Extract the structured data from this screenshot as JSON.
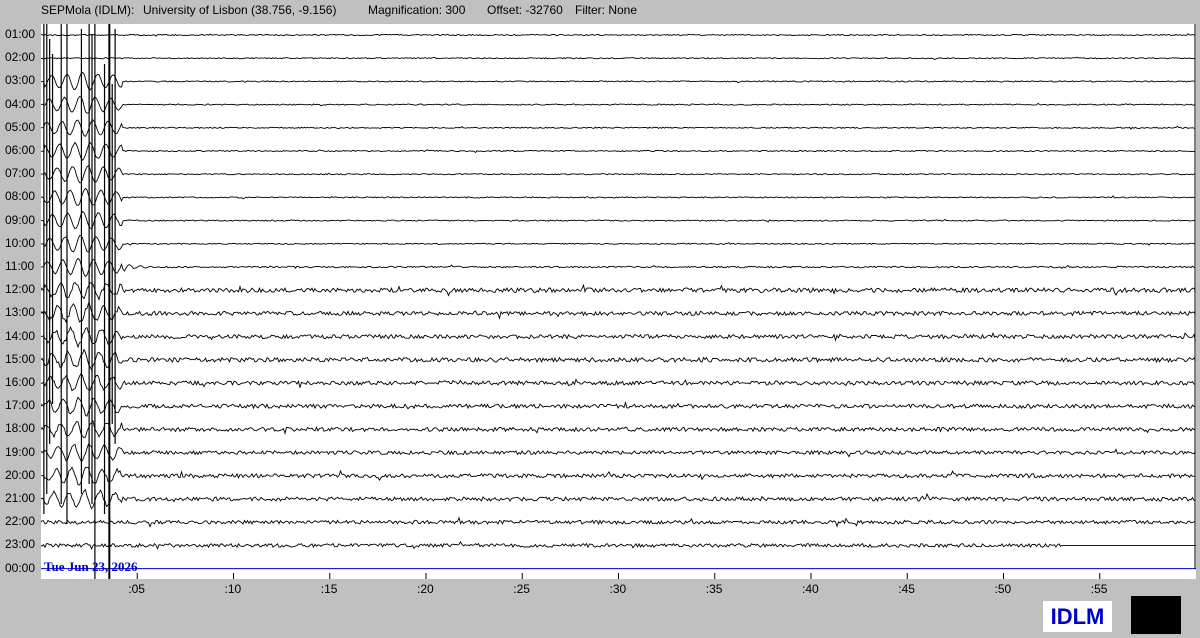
{
  "header": {
    "station": "SEPMola (IDLM):",
    "location": "University of Lisbon (38.756, -9.156)",
    "magnification": "Magnification: 300",
    "offset": "Offset: -32760",
    "filter": "Filter: None"
  },
  "chart_data": {
    "type": "helicorder",
    "hour_labels": [
      "01:00",
      "02:00",
      "03:00",
      "04:00",
      "05:00",
      "06:00",
      "07:00",
      "08:00",
      "09:00",
      "10:00",
      "11:00",
      "12:00",
      "13:00",
      "14:00",
      "15:00",
      "16:00",
      "17:00",
      "18:00",
      "19:00",
      "20:00",
      "21:00",
      "22:00",
      "23:00",
      "00:00"
    ],
    "minute_labels": [
      ":05",
      ":10",
      ":15",
      ":20",
      ":25",
      ":30",
      ":35",
      ":40",
      ":45",
      ":50",
      ":55"
    ],
    "minute_ticks": [
      5,
      10,
      15,
      20,
      25,
      30,
      35,
      40,
      45,
      50,
      55
    ],
    "x_range_minutes": [
      0,
      60
    ],
    "date_label": "Tue Jun 23, 2026",
    "trace_color": "#000000",
    "current_line_color": "#0000cc",
    "noise_amplitude_by_hour": [
      0.6,
      0.6,
      0.6,
      0.6,
      0.6,
      0.6,
      0.6,
      0.6,
      0.6,
      0.6,
      0.8,
      2.2,
      2.0,
      2.0,
      2.2,
      2.0,
      2.0,
      2.0,
      1.8,
      2.0,
      2.0,
      1.8,
      1.8,
      0
    ],
    "last_data_minute": 53,
    "event_onset_minute": 0.2,
    "event_end_minute": 4.2
  },
  "footer": {
    "logo": "IDLM"
  }
}
